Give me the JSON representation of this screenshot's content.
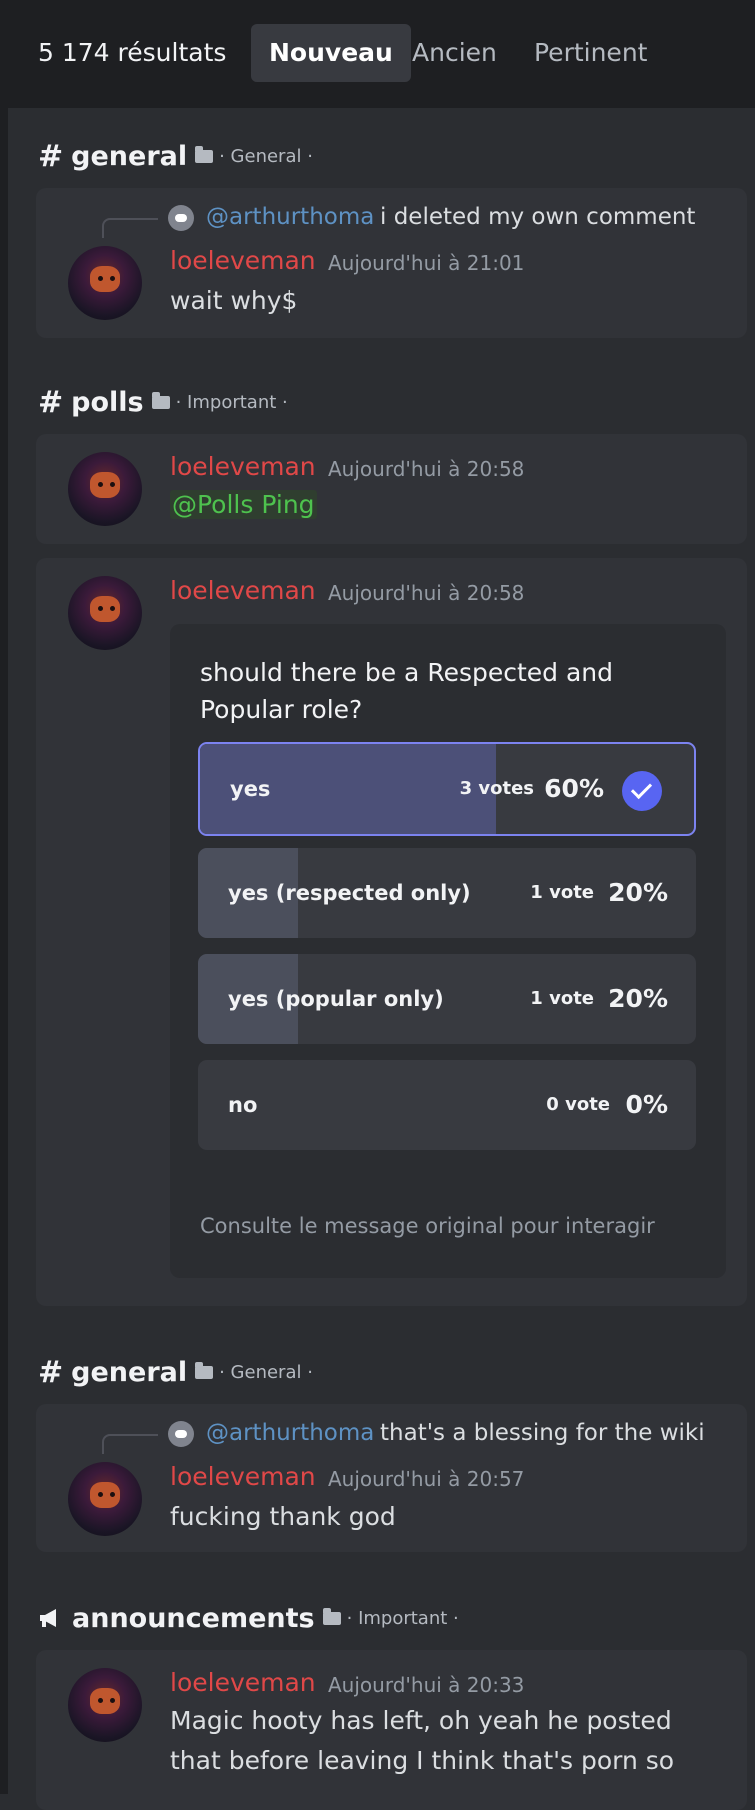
{
  "header": {
    "result_count": "5 174 résultats",
    "tabs": [
      {
        "label": "Nouveau",
        "active": true
      },
      {
        "label": "Ancien",
        "active": false
      },
      {
        "label": "Pertinent",
        "active": false
      }
    ]
  },
  "groups": [
    {
      "channel": "general",
      "category": "· General ·",
      "message": {
        "reply_mention": "@arthurthoma",
        "reply_text": "i deleted my own comment",
        "author": "loeleveman",
        "timestamp": "Aujourd'hui à 21:01",
        "text": "wait why$"
      }
    },
    {
      "channel": "polls",
      "category": "· Important ·",
      "message1": {
        "author": "loeleveman",
        "timestamp": "Aujourd'hui à 20:58",
        "mention": "@Polls Ping"
      },
      "message2": {
        "author": "loeleveman",
        "timestamp": "Aujourd'hui à 20:58",
        "poll": {
          "question": "should there be a Respected and Popular role?",
          "options": [
            {
              "label": "yes",
              "votes": "3 votes",
              "percent": "60%",
              "fraction": 0.6,
              "selected": true
            },
            {
              "label": "yes (respected only)",
              "votes": "1 vote",
              "percent": "20%",
              "fraction": 0.2,
              "selected": false
            },
            {
              "label": "yes (popular only)",
              "votes": "1 vote",
              "percent": "20%",
              "fraction": 0.2,
              "selected": false
            },
            {
              "label": "no",
              "votes": "0 vote",
              "percent": "0%",
              "fraction": 0,
              "selected": false
            }
          ],
          "footer": "Consulte le message original pour interagir"
        }
      }
    },
    {
      "channel": "general",
      "category": "· General ·",
      "message": {
        "reply_mention": "@arthurthoma",
        "reply_text": "that's a blessing for the wiki",
        "author": "loeleveman",
        "timestamp": "Aujourd'hui à 20:57",
        "text": "fucking thank god"
      }
    },
    {
      "channel": "announcements",
      "category": "· Important ·",
      "message": {
        "author": "loeleveman",
        "timestamp": "Aujourd'hui à 20:33",
        "text_line1": "Magic hooty has left, oh yeah he posted",
        "text_line2": "that before leaving I think that's porn so"
      }
    }
  ],
  "colors": {
    "username": "#e04848",
    "mention_reply": "#5e92c4",
    "mention_role": "#4ec24e",
    "accent": "#5865f2"
  },
  "icons": [
    "hash-icon",
    "folder-icon",
    "discord-reply-icon",
    "check-icon",
    "megaphone-icon"
  ]
}
